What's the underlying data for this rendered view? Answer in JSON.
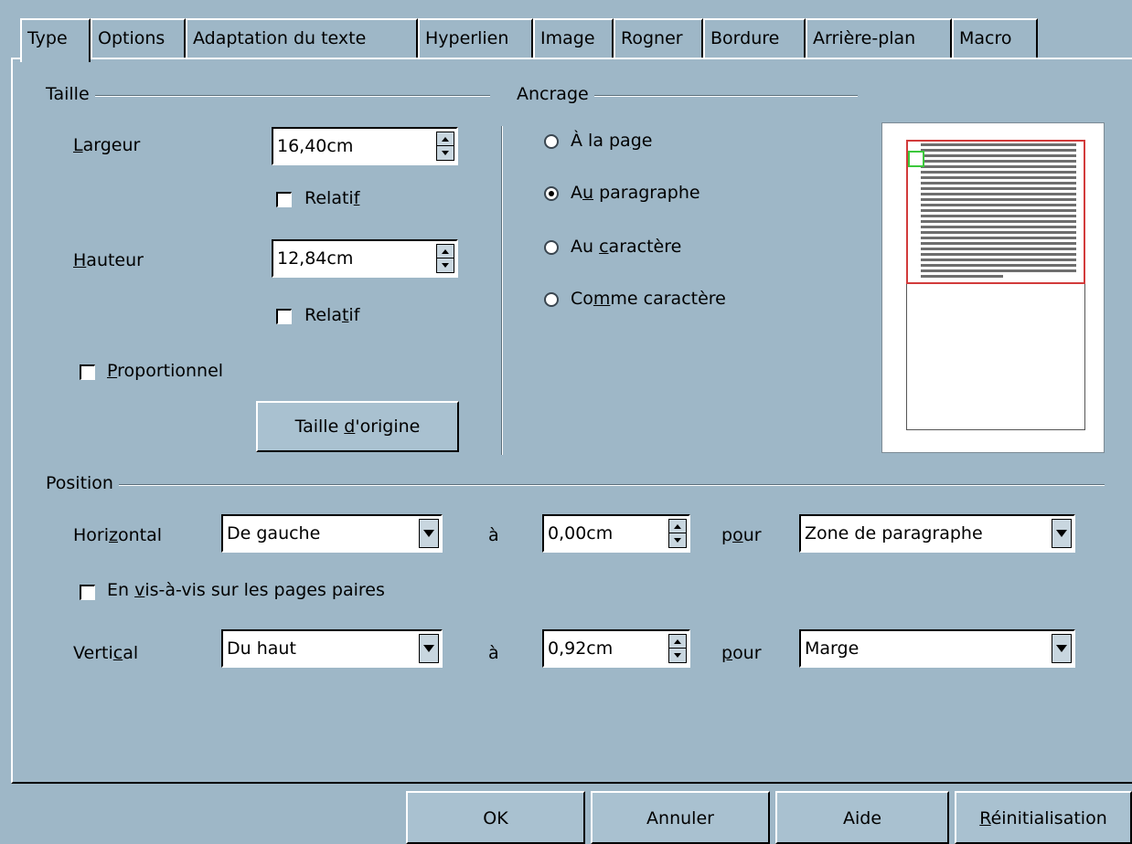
{
  "tabs": [
    {
      "label": "Type",
      "active": true
    },
    {
      "label": "Options",
      "active": false
    },
    {
      "label": "Adaptation du texte",
      "active": false
    },
    {
      "label": "Hyperlien",
      "active": false
    },
    {
      "label": "Image",
      "active": false
    },
    {
      "label": "Rogner",
      "active": false
    },
    {
      "label": "Bordure",
      "active": false
    },
    {
      "label": "Arrière-plan",
      "active": false
    },
    {
      "label": "Macro",
      "active": false
    }
  ],
  "size": {
    "title": "Taille",
    "width_label_pre": "",
    "width_label_ul": "L",
    "width_label_post": "argeur",
    "width_value": "16,40cm",
    "relative1_pre": "Relati",
    "relative1_ul": "f",
    "relative1_post": "",
    "height_label_pre": "",
    "height_label_ul": "H",
    "height_label_post": "auteur",
    "height_value": "12,84cm",
    "relative2_pre": "Rela",
    "relative2_ul": "t",
    "relative2_post": "if",
    "proportional_pre": "",
    "proportional_ul": "P",
    "proportional_post": "roportionnel",
    "original_pre": "Taille ",
    "original_ul": "d",
    "original_post": "'origine"
  },
  "anchor": {
    "title": "Ancrage",
    "options": [
      {
        "pre": "À la pa",
        "ul": "g",
        "post": "e",
        "checked": false
      },
      {
        "pre": "A",
        "ul": "u",
        "post": " paragraphe",
        "checked": true
      },
      {
        "pre": "Au ",
        "ul": "c",
        "post": "aractère",
        "checked": false
      },
      {
        "pre": "Co",
        "ul": "m",
        "post": "me caractère",
        "checked": false
      }
    ]
  },
  "position": {
    "title": "Position",
    "horizontal_pre": "Hori",
    "horizontal_ul": "z",
    "horizontal_post": "ontal",
    "horizontal_value": "De gauche",
    "a1": "à",
    "horizontal_offset": "0,00cm",
    "pour1_pre": "p",
    "pour1_ul": "o",
    "pour1_post": "ur",
    "horizontal_to": "Zone de paragraphe",
    "mirror_pre": "En ",
    "mirror_ul": "v",
    "mirror_post": "is-à-vis sur les pages paires",
    "vertical_pre": "Verti",
    "vertical_ul": "c",
    "vertical_post": "al",
    "vertical_value": "Du haut",
    "a2": "à",
    "vertical_offset": "0,92cm",
    "pour2_pre": "",
    "pour2_ul": "p",
    "pour2_post": "our",
    "vertical_to": "Marge"
  },
  "buttons": {
    "ok": "OK",
    "cancel": "Annuler",
    "help": "Aide",
    "reset_pre": "",
    "reset_ul": "R",
    "reset_post": "éinitialisation"
  }
}
